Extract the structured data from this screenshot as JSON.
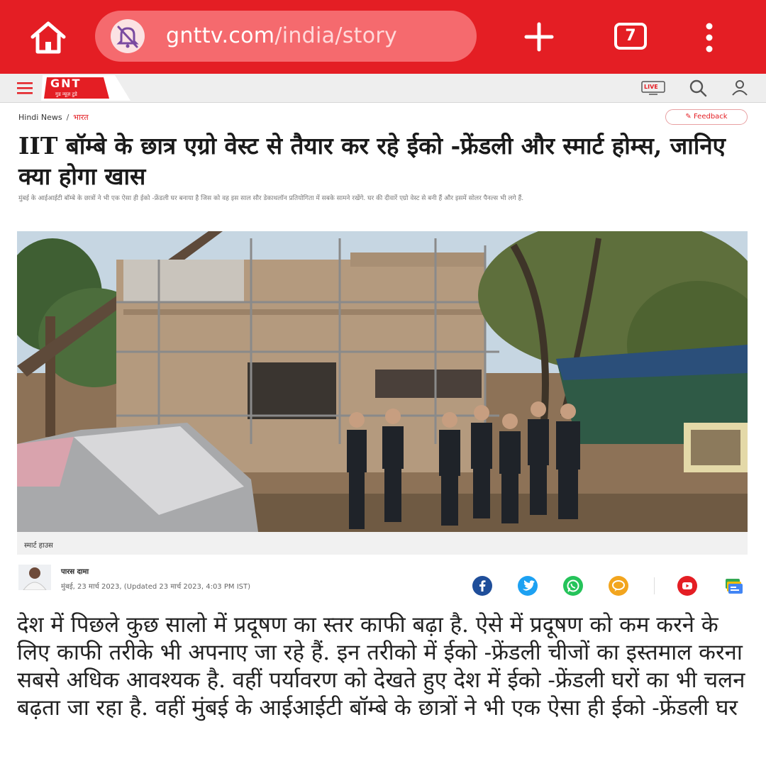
{
  "browser": {
    "url_domain": "gnttv.com",
    "url_path": "/india/story",
    "tab_count": "7",
    "toolbar_color": "#e41e24"
  },
  "site": {
    "logo_text": "GNT",
    "logo_tagline": "गुड न्यूज़ टुडे",
    "live_label": "LIVE",
    "icons": [
      "menu-icon",
      "live-tv-icon",
      "search-icon",
      "user-icon"
    ]
  },
  "breadcrumb": {
    "items": [
      "Hindi News",
      "भारत"
    ],
    "separator": "/"
  },
  "feedback_label": "Feedback",
  "article": {
    "headline": "IIT बॉम्बे के छात्र एग्रो वेस्ट से तैयार कर रहे ईको -फ्रेंडली और स्मार्ट होम्स, जानिए क्या होगा खास",
    "summary": "मुंबई के आईआईटी बॉम्बे के छात्रों ने भी एक ऐसा ही ईको -फ्रेंडली घर बनाया है जिस को वह इस साल सौर डेकाथलॉन प्रतियोगिता में सबके सामने रखेंगे. घर की दीवारें एग्रो वेस्ट से बनी हैं और इसमें सोलर पैनल्स भी लगे हैं.",
    "image_caption": "स्मार्ट हाउस",
    "author": "पारस दामा",
    "dateline": "मुंबई, 23 मार्च 2023, (Updated 23 मार्च 2023, 4:03 PM IST)",
    "body": "देश में पिछले कुछ सालो में प्रदूषण का स्तर काफी बढ़ा है. ऐसे में प्रदूषण को कम करने के लिए काफी तरीके भी अपनाए जा रहे हैं. इन तरीको में ईको -फ्रेंडली चीजों का इस्तमाल करना सबसे अधिक आवश्यक है. वहीं पर्यावरण को देखते हुए देश में ईको -फ्रेंडली घरों का भी चलन बढ़ता जा रहा है. वहीं मुंबई के आईआईटी बॉम्बे के छात्रों ने भी एक ऐसा ही ईको -फ्रेंडली घर"
  },
  "share": [
    {
      "name": "facebook-icon",
      "color": "#1f4e9a"
    },
    {
      "name": "twitter-icon",
      "color": "#1da1f2"
    },
    {
      "name": "whatsapp-icon",
      "color": "#25c35a"
    },
    {
      "name": "comment-icon",
      "color": "#f2a51e"
    },
    {
      "name": "youtube-icon",
      "color": "#e41e24"
    },
    {
      "name": "google-news-icon",
      "color": "#3a7bd5"
    }
  ]
}
